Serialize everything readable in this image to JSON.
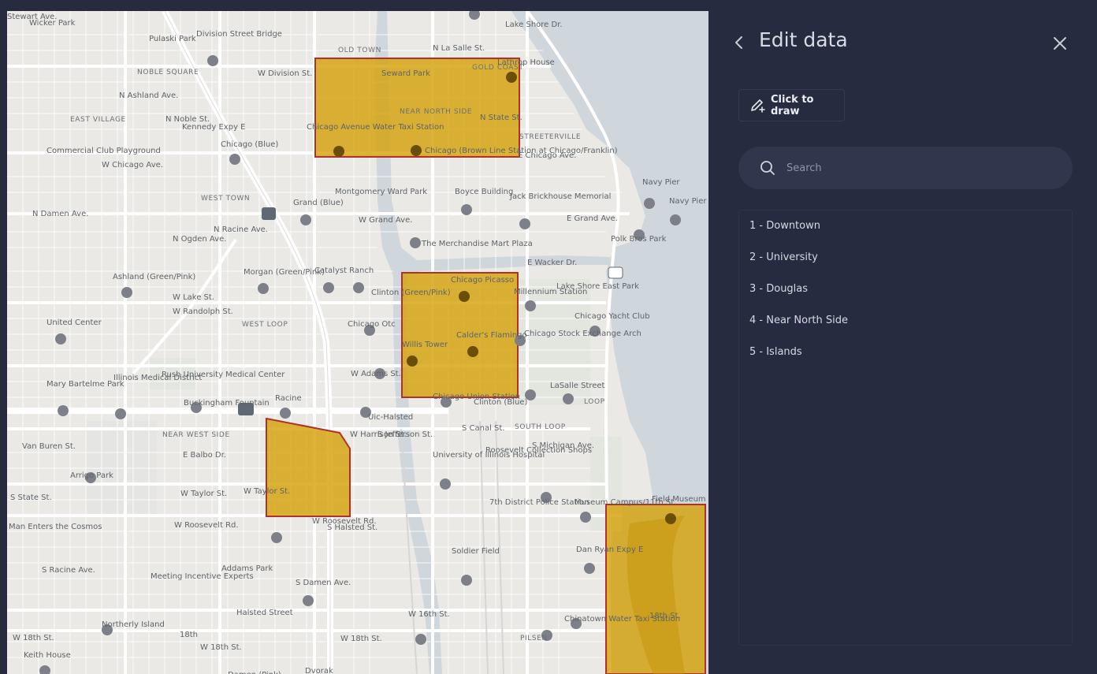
{
  "panel": {
    "title": "Edit data",
    "draw_button_label": "Click to draw",
    "search_placeholder": "Search",
    "regions": [
      "1 - Downtown",
      "2 - University",
      "3 - Douglas",
      "4 - Near North Side",
      "5 - Islands"
    ]
  },
  "colors": {
    "panel_bg": "#262b3f",
    "polygon_fill": "#d4a20b",
    "polygon_stroke": "#b0302a",
    "map_bg": "#eae9e5",
    "water": "#cfd6dc"
  },
  "map": {
    "labels": [
      "Wicker Park",
      "Pulaski Park",
      "Division Street Bridge",
      "OLD TOWN",
      "N La Salle St.",
      "Lake Shore Dr.",
      "NOBLE SQUARE",
      "W Division St.",
      "Seward Park",
      "GOLD COAST",
      "Lathrop House",
      "N Ashland Ave.",
      "N Noble St.",
      "Kennedy Expy E",
      "NEAR NORTH SIDE",
      "N State St.",
      "EAST VILLAGE",
      "Chicago Avenue Water Taxi Station",
      "STREETERVILLE",
      "Commercial Club Playground",
      "Chicago (Blue)",
      "Chicago (Brown Line Station at Chicago/Franklin)",
      "E Chicago Ave.",
      "W Chicago Ave.",
      "Navy Pier",
      "Navy Pier",
      "N Damen Ave.",
      "WEST TOWN",
      "Grand (Blue)",
      "Montgomery Ward Park",
      "Boyce Building",
      "Jack Brickhouse Memorial",
      "E Grand Ave.",
      "W Grand Ave.",
      "N Ogden Ave.",
      "N Racine Ave.",
      "Polk Bros Park",
      "The Merchandise Mart Plaza",
      "E Wacker Dr.",
      "Ashland (Green/Pink)",
      "Morgan (Green/Pink)",
      "Catalyst Ranch",
      "Clinton (Green/Pink)",
      "Chicago Picasso",
      "Millennium Station",
      "Lake Shore East Park",
      "W Lake St.",
      "W Randolph St.",
      "WEST LOOP",
      "Chicago Otc",
      "Willis Tower",
      "Calder's Flamingo",
      "Chicago Yacht Club",
      "United Center",
      "Chicago Stock Exchange Arch",
      "Mary Bartelme Park",
      "Illinois Medical District",
      "Rush University Medical Center",
      "W Adams St.",
      "Chicago Union Station",
      "LaSalle Street",
      "LOOP",
      "Buckingham Fountain",
      "Racine",
      "Uic-Halsted",
      "Clinton (Blue)",
      "Van Buren St.",
      "NEAR WEST SIDE",
      "W Harrison St.",
      "S Jefferson St.",
      "S Canal St.",
      "SOUTH LOOP",
      "S Michigan Ave.",
      "E Balbo Dr.",
      "Arrigo Park",
      "University of Illinois Hospital",
      "Roosevelt Collection Shops",
      "S State St.",
      "W Taylor St.",
      "W Taylor St.",
      "7th District Police Station",
      "Museum Campus/11th St.",
      "Field Museum",
      "Man Enters the Cosmos",
      "W Roosevelt Rd.",
      "W Roosevelt Rd.",
      "S Halsted St.",
      "Dan Ryan Expy E",
      "Soldier Field",
      "Meeting Incentive Experts",
      "Addams Park",
      "S Racine Ave.",
      "S Damen Ave.",
      "Halsted Street",
      "W 16th St.",
      "Chinatown Water Taxi Station",
      "18th St.",
      "Northerly Island",
      "18th",
      "W 18th St.",
      "W 18th St.",
      "W 18th St.",
      "PILSEN",
      "Keith House",
      "Damen (Pink)",
      "Dvorak",
      "Stewart Ave."
    ]
  }
}
